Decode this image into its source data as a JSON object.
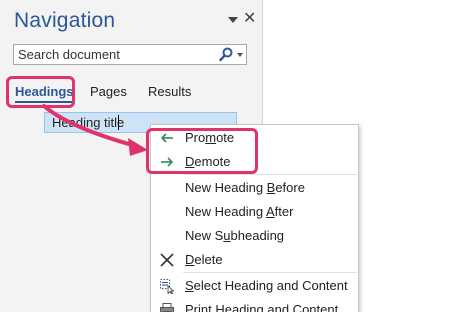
{
  "nav_pane": {
    "title": "Navigation",
    "menu_icon": "dropdown-arrow-icon",
    "close_icon": "close-icon",
    "close_glyph": "✕"
  },
  "search": {
    "placeholder": "Search document",
    "icon": "search-icon",
    "dropdown_icon": "chevron-down-icon"
  },
  "tabs": [
    {
      "label": "Headings",
      "selected": true
    },
    {
      "label": "Pages",
      "selected": false
    },
    {
      "label": "Results",
      "selected": false
    }
  ],
  "headings_tree": [
    {
      "label": "Heading title",
      "selected": true
    }
  ],
  "context_menu": {
    "items": [
      {
        "label_parts": [
          "Pro",
          "m",
          "ote"
        ],
        "icon": "promote-arrow-icon"
      },
      {
        "label_parts": [
          "",
          "D",
          "emote"
        ],
        "icon": "demote-arrow-icon"
      },
      {
        "label_parts": [
          "New Heading ",
          "B",
          "efore"
        ],
        "icon": ""
      },
      {
        "label_parts": [
          "New Heading ",
          "A",
          "fter"
        ],
        "icon": ""
      },
      {
        "label_parts": [
          "New S",
          "u",
          "bheading"
        ],
        "icon": ""
      },
      {
        "label_parts": [
          "",
          "D",
          "elete"
        ],
        "icon": "delete-x-icon"
      },
      {
        "label_parts": [
          "",
          "S",
          "elect Heading and Content"
        ],
        "icon": "select-heading-icon"
      },
      {
        "label_parts": [
          "",
          "P",
          "rint Heading and Content"
        ],
        "icon": "print-icon"
      }
    ]
  },
  "colors": {
    "accent": "#2b579a",
    "highlight_callout": "#e0336a",
    "pane_background": "#f3f3f3",
    "selection": "#cfe3f7",
    "promote_demote_arrow": "#2e8b57"
  }
}
